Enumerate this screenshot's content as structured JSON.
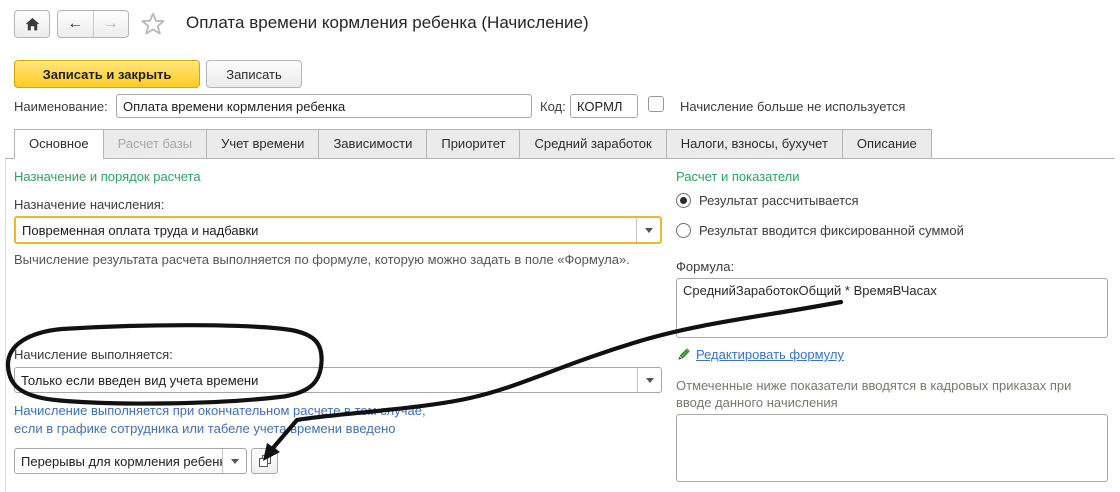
{
  "window": {
    "title": "Оплата времени кормления ребенка (Начисление)"
  },
  "toolbar": {
    "save_close_label": "Записать и закрыть",
    "save_label": "Записать"
  },
  "header_fields": {
    "name_label": "Наименование:",
    "name_value": "Оплата времени кормления ребенка",
    "code_label": "Код:",
    "code_value": "КОРМЛ",
    "not_used_label": "Начисление больше не используется",
    "not_used_checked": false
  },
  "tabs": [
    {
      "label": "Основное",
      "state": "active"
    },
    {
      "label": "Расчет базы",
      "state": "disabled"
    },
    {
      "label": "Учет времени",
      "state": "normal"
    },
    {
      "label": "Зависимости",
      "state": "normal"
    },
    {
      "label": "Приоритет",
      "state": "normal"
    },
    {
      "label": "Средний заработок",
      "state": "normal"
    },
    {
      "label": "Налоги, взносы, бухучет",
      "state": "normal"
    },
    {
      "label": "Описание",
      "state": "normal"
    }
  ],
  "left_panel": {
    "section_title": "Назначение и порядок расчета",
    "purpose_label": "Назначение начисления:",
    "purpose_value": "Повременная оплата труда и надбавки",
    "purpose_hint": "Вычисление результата расчета выполняется по формуле, которую можно задать в поле «Формула».",
    "performed_label": "Начисление выполняется:",
    "performed_value": "Только если введен вид учета времени",
    "performed_hint_line1": "Начисление выполняется при окончательном расчете в том случае,",
    "performed_hint_line2": "если в графике сотрудника или табеле учета времени введено",
    "time_kind_value": "Перерывы для кормления ребенк"
  },
  "right_panel": {
    "section_title": "Расчет и показатели",
    "radio_calculated": "Результат рассчитывается",
    "radio_fixed": "Результат вводится фиксированной суммой",
    "radio_selected": "Результат рассчитывается",
    "formula_label": "Формула:",
    "formula_value": "СреднийЗаработокОбщий * ВремяВЧасах",
    "edit_formula_link": "Редактировать формулу",
    "indicators_hint": "Отмеченные ниже показатели вводятся в кадровых приказах при вводе данного начисления"
  },
  "icons": {
    "back_glyph": "←",
    "forward_glyph": "→"
  },
  "colors": {
    "accent_yellow_button": "#fecb22",
    "required_field_outline": "#eaba2b",
    "section_title_green": "#2aa561",
    "info_text_blue": "#4070b8",
    "link_blue": "#3672ce",
    "annotation_ink": "#111111"
  }
}
